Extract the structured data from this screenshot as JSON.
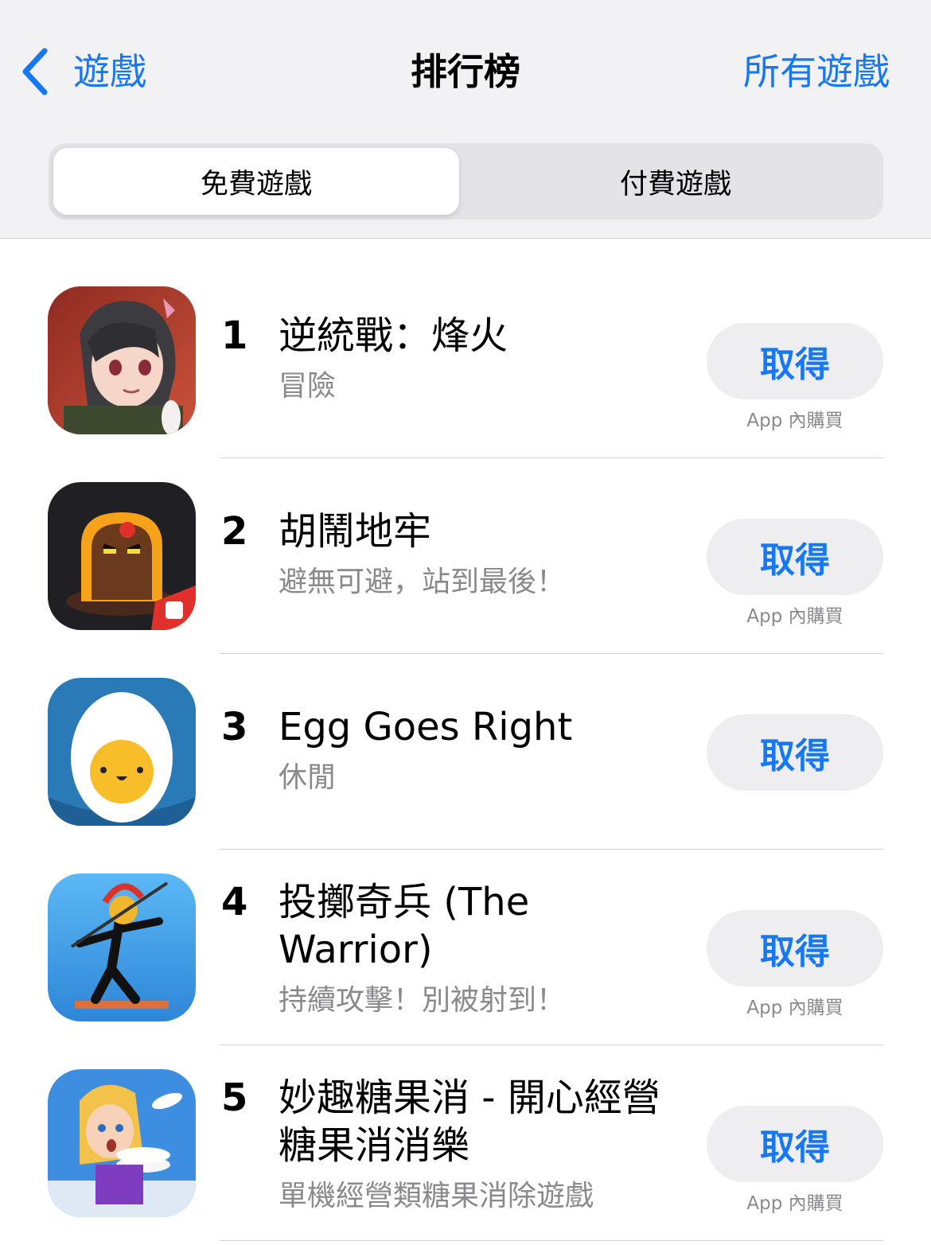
{
  "nav": {
    "back_label": "遊戲",
    "title": "排行榜",
    "right_label": "所有遊戲"
  },
  "segments": {
    "free": "免費遊戲",
    "paid": "付費遊戲",
    "selected": "free"
  },
  "apps": [
    {
      "rank": "1",
      "title": "逆統戰：烽火",
      "subtitle": "冒險",
      "button": "取得",
      "iap": "App 內購買",
      "icon": "anime-girl-icon"
    },
    {
      "rank": "2",
      "title": "胡鬧地牢",
      "subtitle": "避無可避，站到最後！",
      "button": "取得",
      "iap": "App 內購買",
      "icon": "dungeon-character-icon"
    },
    {
      "rank": "3",
      "title": "Egg Goes Right",
      "subtitle": "休閒",
      "button": "取得",
      "iap": "",
      "icon": "egg-icon"
    },
    {
      "rank": "4",
      "title": "投擲奇兵 (The Warrior)",
      "subtitle": "持續攻擊！別被射到！",
      "button": "取得",
      "iap": "App 內購買",
      "icon": "spartan-warrior-icon"
    },
    {
      "rank": "5",
      "title": "妙趣糖果消 - 開心經營糖果消消樂",
      "subtitle": "單機經營類糖果消除遊戲",
      "button": "取得",
      "iap": "App 內購買",
      "icon": "waitress-plates-icon"
    }
  ],
  "colors": {
    "accent": "#1877f2",
    "header_bg": "#f2f2f4",
    "button_bg": "#eeeef1",
    "secondary_text": "#8a8a8e"
  }
}
